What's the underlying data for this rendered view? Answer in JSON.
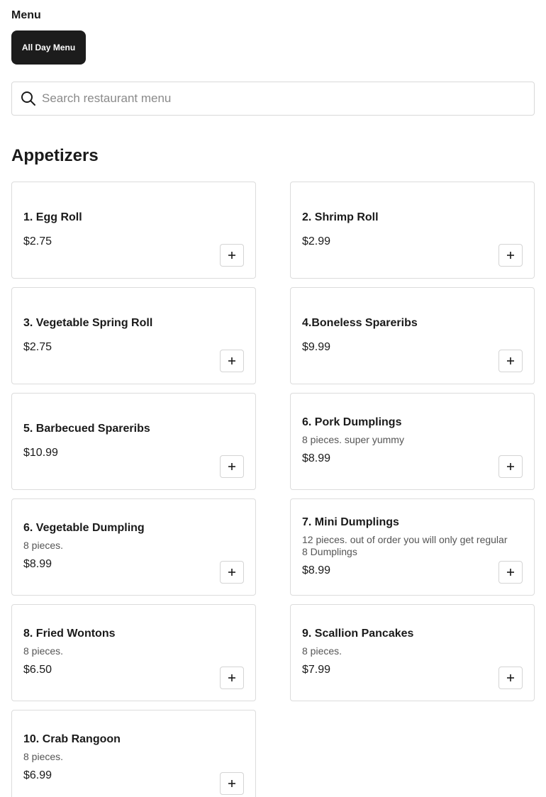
{
  "header": {
    "menu_label": "Menu",
    "tab_label": "All Day Menu"
  },
  "search": {
    "placeholder": "Search restaurant menu",
    "value": ""
  },
  "section": {
    "title": "Appetizers"
  },
  "items": [
    {
      "name": "1. Egg Roll",
      "description": "",
      "price": "$2.75"
    },
    {
      "name": "2. Shrimp Roll",
      "description": "",
      "price": "$2.99"
    },
    {
      "name": "3. Vegetable Spring Roll",
      "description": "",
      "price": "$2.75"
    },
    {
      "name": "4.Boneless Spareribs",
      "description": "",
      "price": "$9.99"
    },
    {
      "name": "5. Barbecued Spareribs",
      "description": "",
      "price": "$10.99"
    },
    {
      "name": "6. Pork Dumplings",
      "description": "8 pieces. super yummy",
      "price": "$8.99"
    },
    {
      "name": "6. Vegetable Dumpling",
      "description": "8 pieces.",
      "price": "$8.99"
    },
    {
      "name": "7. Mini Dumplings",
      "description": "12 pieces. out of order you will only get regular 8 Dumplings",
      "price": "$8.99"
    },
    {
      "name": "8. Fried Wontons",
      "description": "8 pieces.",
      "price": "$6.50"
    },
    {
      "name": "9. Scallion Pancakes",
      "description": "8 pieces.",
      "price": "$7.99"
    },
    {
      "name": "10. Crab Rangoon",
      "description": "8 pieces.",
      "price": "$6.99"
    }
  ],
  "icons": {
    "search": "search-icon",
    "add": "plus-icon"
  },
  "colors": {
    "tab_background": "#1c1c1c",
    "tab_text": "#ffffff",
    "border": "#dcdcdc"
  }
}
